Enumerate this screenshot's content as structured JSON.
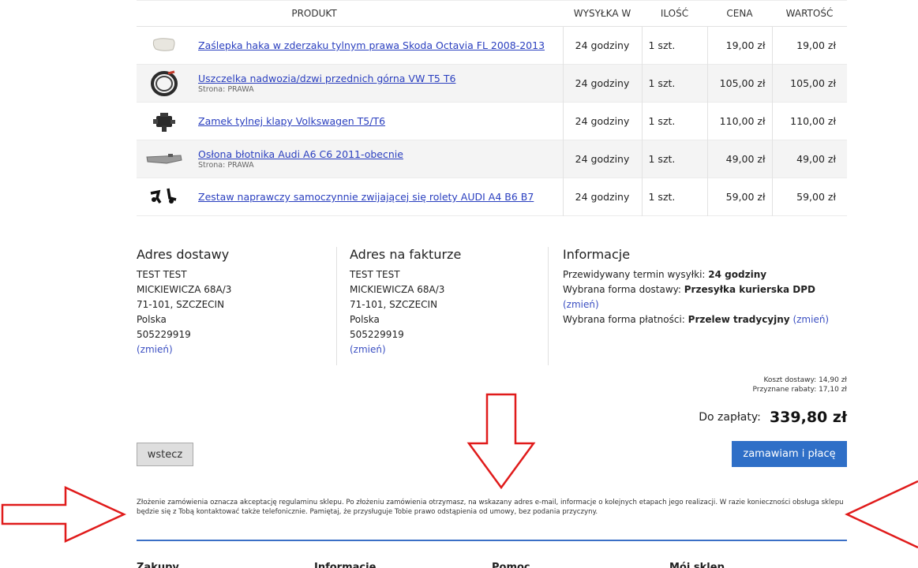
{
  "table": {
    "headers": {
      "product": "PRODUKT",
      "shipping": "WYSYŁKA W",
      "qty": "ILOŚĆ",
      "price": "CENA",
      "total": "WARTOŚĆ"
    },
    "rows": [
      {
        "name": "Zaślepka haka w zderzaku tylnym prawa Skoda Octavia FL 2008-2013",
        "sub": "",
        "shipping": "24 godziny",
        "qty": "1 szt.",
        "price": "19,00 zł",
        "total": "19,00 zł",
        "thumb": "tow-hook-cap-icon"
      },
      {
        "name": "Uszczelka nadwozia/dzwi przednich górna VW T5 T6",
        "sub": "Strona: PRAWA",
        "shipping": "24 godziny",
        "qty": "1 szt.",
        "price": "105,00 zł",
        "total": "105,00 zł",
        "thumb": "rubber-seal-icon"
      },
      {
        "name": "Zamek tylnej klapy Volkswagen T5/T6",
        "sub": "",
        "shipping": "24 godziny",
        "qty": "1 szt.",
        "price": "110,00 zł",
        "total": "110,00 zł",
        "thumb": "lock-icon"
      },
      {
        "name": "Osłona błotnika Audi A6 C6 2011-obecnie",
        "sub": "Strona: PRAWA",
        "shipping": "24 godziny",
        "qty": "1 szt.",
        "price": "49,00 zł",
        "total": "49,00 zł",
        "thumb": "fender-cover-icon"
      },
      {
        "name": "Zestaw naprawczy samoczynnie zwijającej się rolety AUDI A4 B6 B7",
        "sub": "",
        "shipping": "24 godziny",
        "qty": "1 szt.",
        "price": "59,00 zł",
        "total": "59,00 zł",
        "thumb": "repair-kit-icon"
      }
    ]
  },
  "delivery": {
    "title": "Adres dostawy",
    "lines": [
      "TEST TEST",
      "MICKIEWICZA 68A/3",
      "71-101, SZCZECIN",
      "Polska",
      "505229919"
    ],
    "change": "(zmień)"
  },
  "invoice": {
    "title": "Adres na fakturze",
    "lines": [
      "TEST TEST",
      "MICKIEWICZA 68A/3",
      "71-101, SZCZECIN",
      "Polska",
      "505229919"
    ],
    "change": "(zmień)"
  },
  "information": {
    "title": "Informacje",
    "eta_label": "Przewidywany termin wysyłki:",
    "eta_value": "24 godziny",
    "delivery_label": "Wybrana forma dostawy:",
    "delivery_value": "Przesyłka kurierska DPD",
    "payment_label": "Wybrana forma płatności:",
    "payment_value": "Przelew tradycyjny",
    "change": "(zmień)"
  },
  "summary": {
    "shipping_cost": "Koszt dostawy: 14,90 zł",
    "discounts": "Przyznane rabaty: 17,10 zł",
    "to_pay_label": "Do zapłaty:",
    "to_pay_amount": "339,80 zł"
  },
  "buttons": {
    "back": "wstecz",
    "order": "zamawiam i płacę"
  },
  "terms": "Złożenie zamówienia oznacza akceptację regulaminu sklepu. Po złożeniu zamówienia otrzymasz, na wskazany adres e-mail, informacje o kolejnych etapach jego realizacji. W razie konieczności obsługa sklepu będzie się z Tobą kontaktować także telefonicznie. Pamiętaj, że przysługuje Tobie prawo odstąpienia od umowy, bez podania przyczyny.",
  "footer": {
    "heads": [
      "Zakupy",
      "Informacje",
      "Pomoc",
      "Mój sklep"
    ]
  },
  "colors": {
    "accent": "#2f6fc7",
    "link": "#2a3fbf",
    "annotation": "#e01b1b"
  }
}
